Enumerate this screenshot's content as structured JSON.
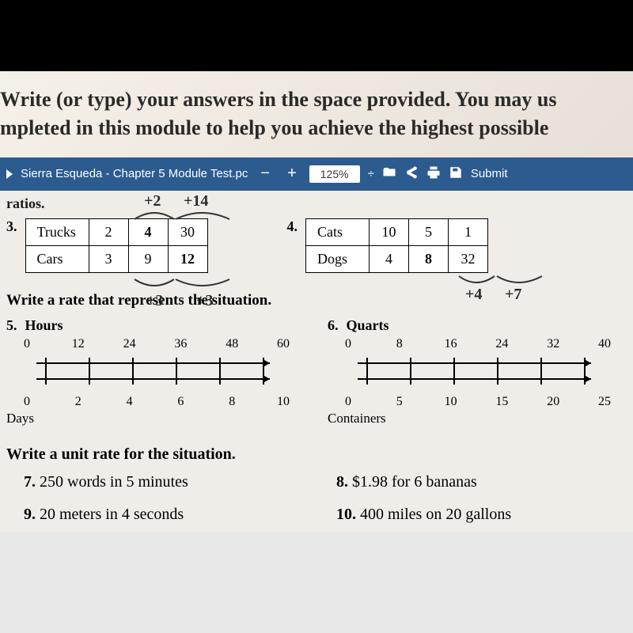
{
  "instructions": {
    "line1": "Write (or type) your answers in the space provided.  You may us",
    "line2": "mpleted in this module to help you achieve the highest possible"
  },
  "toolbar": {
    "filename": "Sierra Esqueda - Chapter 5 Module Test.pc",
    "minus": "−",
    "plus": "+",
    "zoom": "125%",
    "submit": "Submit"
  },
  "ratios_label": "ratios.",
  "handwriting": {
    "top2": "+2",
    "top14": "+14",
    "bot3a": "+3",
    "bot3b": "+3",
    "right4": "+4",
    "right7": "+7"
  },
  "problem3": {
    "num": "3.",
    "row1": [
      "Trucks",
      "2",
      "4",
      "30"
    ],
    "row2": [
      "Cars",
      "3",
      "9",
      "12"
    ],
    "hand_idx_r1": 2,
    "hand_idx_r2": 3
  },
  "problem4": {
    "num": "4.",
    "row1": [
      "Cats",
      "10",
      "5",
      "1"
    ],
    "row2": [
      "Dogs",
      "4",
      "8",
      "32"
    ],
    "hand_idx_r2": 2
  },
  "rate_heading": "Write a rate that represents the situation.",
  "problem5": {
    "num": "5.",
    "top_label": "Hours",
    "top_ticks": [
      "0",
      "12",
      "24",
      "36",
      "48",
      "60"
    ],
    "bot_ticks": [
      "0",
      "2",
      "4",
      "6",
      "8",
      "10"
    ],
    "bot_label": "Days"
  },
  "problem6": {
    "num": "6.",
    "top_label": "Quarts",
    "top_ticks": [
      "0",
      "8",
      "16",
      "24",
      "32",
      "40"
    ],
    "bot_ticks": [
      "0",
      "5",
      "10",
      "15",
      "20",
      "25"
    ],
    "bot_label": "Containers"
  },
  "unit_heading": "Write a unit rate for the situation.",
  "q7": {
    "num": "7.",
    "text": "250 words in 5 minutes"
  },
  "q8": {
    "num": "8.",
    "text": "$1.98 for 6 bananas"
  },
  "q9": {
    "num": "9.",
    "text": "20 meters in 4 seconds"
  },
  "q10": {
    "num": "10.",
    "text": "400 miles on 20 gallons"
  }
}
